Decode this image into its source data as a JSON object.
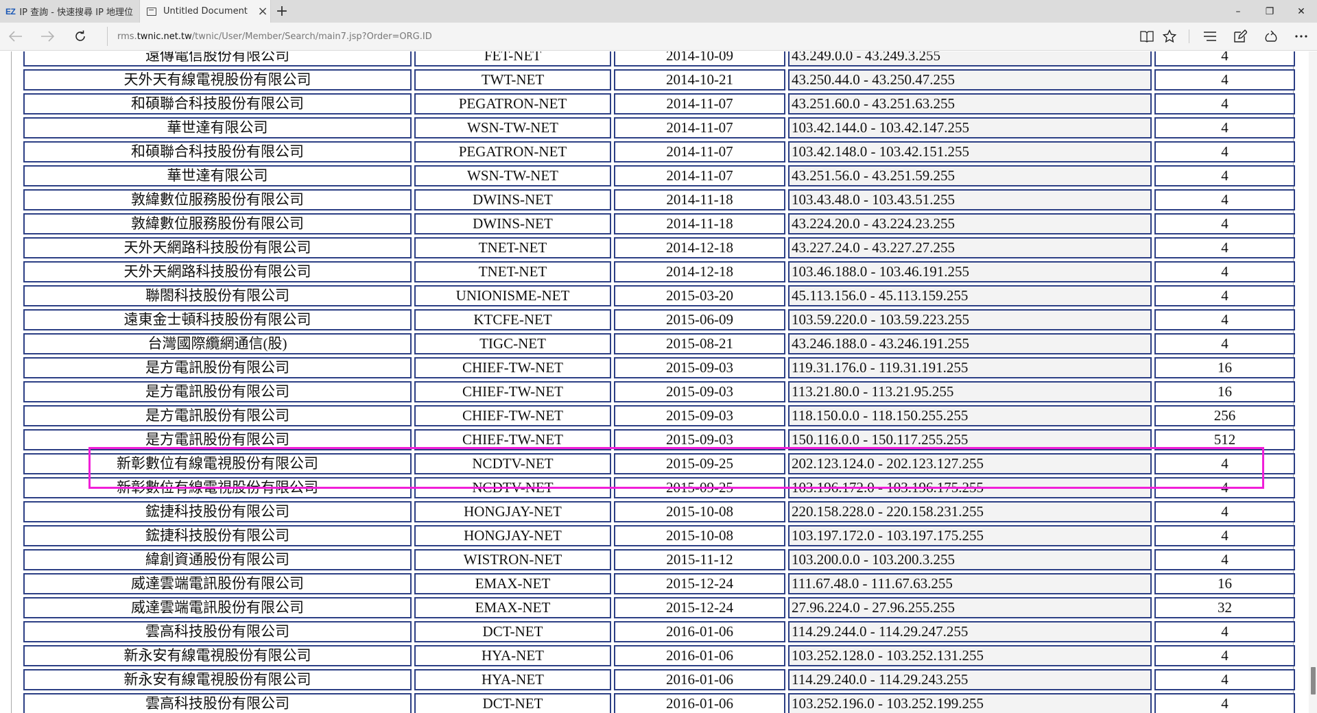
{
  "tabs": [
    {
      "favicon": "EZ",
      "title": "IP 查詢 - 快速搜尋 IP 地理位"
    },
    {
      "title": "Untitled Document"
    }
  ],
  "window": {
    "minimize": "–",
    "restore": "❐",
    "close": "✕"
  },
  "address": {
    "prefix": "rms.",
    "host": "twnic.net.tw",
    "path": "/twnic/User/Member/Search/main7.jsp?Order=ORG.ID"
  },
  "table": {
    "partial_row": {
      "org": "遠傳電信股份有限公司",
      "net": "FET-NET",
      "date": "2014-10-09",
      "ip": "43.249.0.0 - 43.249.3.255",
      "count": "4"
    },
    "rows": [
      {
        "org": "天外天有線電視股份有限公司",
        "net": "TWT-NET",
        "date": "2014-10-21",
        "ip": "43.250.44.0 - 43.250.47.255",
        "count": "4"
      },
      {
        "org": "和碩聯合科技股份有限公司",
        "net": "PEGATRON-NET",
        "date": "2014-11-07",
        "ip": "43.251.60.0 - 43.251.63.255",
        "count": "4"
      },
      {
        "org": "華世達有限公司",
        "net": "WSN-TW-NET",
        "date": "2014-11-07",
        "ip": "103.42.144.0 - 103.42.147.255",
        "count": "4"
      },
      {
        "org": "和碩聯合科技股份有限公司",
        "net": "PEGATRON-NET",
        "date": "2014-11-07",
        "ip": "103.42.148.0 - 103.42.151.255",
        "count": "4"
      },
      {
        "org": "華世達有限公司",
        "net": "WSN-TW-NET",
        "date": "2014-11-07",
        "ip": "43.251.56.0 - 43.251.59.255",
        "count": "4"
      },
      {
        "org": "敦緯數位服務股份有限公司",
        "net": "DWINS-NET",
        "date": "2014-11-18",
        "ip": "103.43.48.0 - 103.43.51.255",
        "count": "4"
      },
      {
        "org": "敦緯數位服務股份有限公司",
        "net": "DWINS-NET",
        "date": "2014-11-18",
        "ip": "43.224.20.0 - 43.224.23.255",
        "count": "4"
      },
      {
        "org": "天外天網路科技股份有限公司",
        "net": "TNET-NET",
        "date": "2014-12-18",
        "ip": "43.227.24.0 - 43.227.27.255",
        "count": "4"
      },
      {
        "org": "天外天網路科技股份有限公司",
        "net": "TNET-NET",
        "date": "2014-12-18",
        "ip": "103.46.188.0 - 103.46.191.255",
        "count": "4"
      },
      {
        "org": "聯閤科技股份有限公司",
        "net": "UNIONISME-NET",
        "date": "2015-03-20",
        "ip": "45.113.156.0 - 45.113.159.255",
        "count": "4"
      },
      {
        "org": "遠東金士頓科技股份有限公司",
        "net": "KTCFE-NET",
        "date": "2015-06-09",
        "ip": "103.59.220.0 - 103.59.223.255",
        "count": "4"
      },
      {
        "org": "台灣國際纜網通信(股)",
        "net": "TIGC-NET",
        "date": "2015-08-21",
        "ip": "43.246.188.0 - 43.246.191.255",
        "count": "4"
      },
      {
        "org": "是方電訊股份有限公司",
        "net": "CHIEF-TW-NET",
        "date": "2015-09-03",
        "ip": "119.31.176.0 - 119.31.191.255",
        "count": "16"
      },
      {
        "org": "是方電訊股份有限公司",
        "net": "CHIEF-TW-NET",
        "date": "2015-09-03",
        "ip": "113.21.80.0 - 113.21.95.255",
        "count": "16"
      },
      {
        "org": "是方電訊股份有限公司",
        "net": "CHIEF-TW-NET",
        "date": "2015-09-03",
        "ip": "118.150.0.0 - 118.150.255.255",
        "count": "256"
      },
      {
        "org": "是方電訊股份有限公司",
        "net": "CHIEF-TW-NET",
        "date": "2015-09-03",
        "ip": "150.116.0.0 - 150.117.255.255",
        "count": "512"
      },
      {
        "org": "新彰數位有線電視股份有限公司",
        "net": "NCDTV-NET",
        "date": "2015-09-25",
        "ip": "202.123.124.0 - 202.123.127.255",
        "count": "4"
      },
      {
        "org": "新彰數位有線電視股份有限公司",
        "net": "NCDTV-NET",
        "date": "2015-09-25",
        "ip": "103.196.172.0 - 103.196.175.255",
        "count": "4"
      },
      {
        "org": "鋐捷科技股份有限公司",
        "net": "HONGJAY-NET",
        "date": "2015-10-08",
        "ip": "220.158.228.0 - 220.158.231.255",
        "count": "4"
      },
      {
        "org": "鋐捷科技股份有限公司",
        "net": "HONGJAY-NET",
        "date": "2015-10-08",
        "ip": "103.197.172.0 - 103.197.175.255",
        "count": "4"
      },
      {
        "org": "緯創資通股份有限公司",
        "net": "WISTRON-NET",
        "date": "2015-11-12",
        "ip": "103.200.0.0 - 103.200.3.255",
        "count": "4"
      },
      {
        "org": "威達雲端電訊股份有限公司",
        "net": "EMAX-NET",
        "date": "2015-12-24",
        "ip": "111.67.48.0 - 111.67.63.255",
        "count": "16"
      },
      {
        "org": "威達雲端電訊股份有限公司",
        "net": "EMAX-NET",
        "date": "2015-12-24",
        "ip": "27.96.224.0 - 27.96.255.255",
        "count": "32"
      },
      {
        "org": "雲高科技股份有限公司",
        "net": "DCT-NET",
        "date": "2016-01-06",
        "ip": "114.29.244.0 - 114.29.247.255",
        "count": "4"
      },
      {
        "org": "新永安有線電視股份有限公司",
        "net": "HYA-NET",
        "date": "2016-01-06",
        "ip": "103.252.128.0 - 103.252.131.255",
        "count": "4"
      },
      {
        "org": "新永安有線電視股份有限公司",
        "net": "HYA-NET",
        "date": "2016-01-06",
        "ip": "114.29.240.0 - 114.29.243.255",
        "count": "4"
      },
      {
        "org": "雲高科技股份有限公司",
        "net": "DCT-NET",
        "date": "2016-01-06",
        "ip": "103.252.196.0 - 103.252.199.255",
        "count": "4"
      }
    ]
  },
  "highlight": {
    "color": "#f01fd8",
    "rows": [
      16,
      17
    ]
  },
  "colors": {
    "cell_border": "#2b3e84",
    "ip_cell_bg": "#f3f3f3",
    "tabstrip_bg": "#dcdcdc"
  }
}
